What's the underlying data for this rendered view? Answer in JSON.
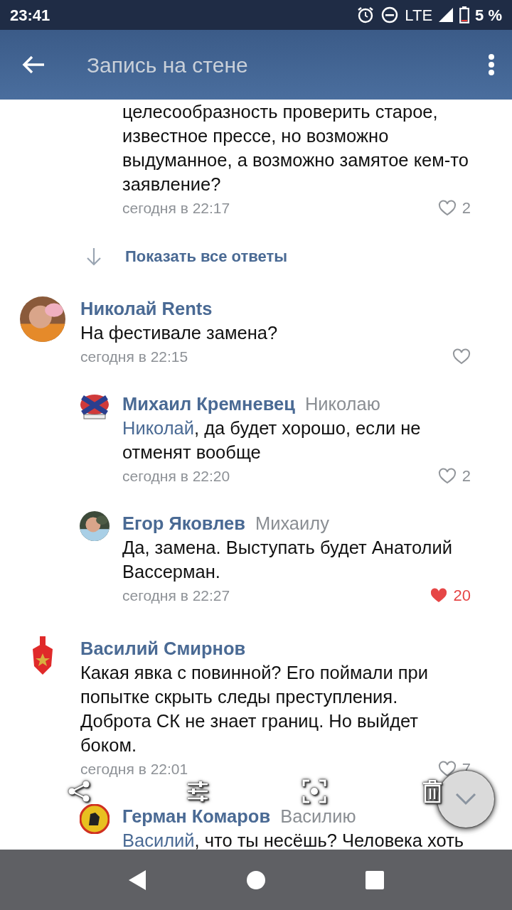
{
  "status_bar": {
    "time": "23:41",
    "network": "LTE",
    "battery": "5 %"
  },
  "header": {
    "title": "Запись на стене"
  },
  "comments": [
    {
      "kind": "reply",
      "text": "целесообразность проверить старое, известное прессе, но возможно выдуманное, а возможно замятое кем-то заявление?",
      "time": "сегодня в 22:17",
      "likes": "2",
      "liked": false
    },
    {
      "kind": "more",
      "label": "Показать все ответы"
    },
    {
      "kind": "top",
      "author": "Николай Rents",
      "text": "На фестивале замена?",
      "time": "сегодня в 22:15",
      "liked": false
    },
    {
      "kind": "reply",
      "avatar": {
        "kind": "flag"
      },
      "author": "Михаил Кремневец",
      "reply_to": "Николаю",
      "mention": "Николай",
      "text": ", да будет хорошо, если не отменят вообще",
      "time": "сегодня в 22:20",
      "likes": "2",
      "liked": false
    },
    {
      "kind": "reply",
      "author": "Егор Яковлев",
      "reply_to": "Михаилу",
      "text": "Да, замена. Выступать будет Анатолий Вассерман.",
      "time": "сегодня в 22:27",
      "likes": "20",
      "liked": true
    },
    {
      "kind": "top",
      "avatar": {
        "kind": "shield"
      },
      "author": "Василий Смирнов",
      "text": "Какая явка с повинной? Его поймали при попытке скрыть следы преступления. Доброта СК не знает границ. Но выйдет боком.",
      "time": "сегодня в 22:01",
      "likes": "7",
      "liked": false
    },
    {
      "kind": "reply",
      "avatar": {
        "kind": "emblem"
      },
      "author": "Герман Комаров",
      "reply_to": "Василию",
      "mention": "Василий",
      "text": ", что ты несёшь? Человека хоть"
    }
  ]
}
